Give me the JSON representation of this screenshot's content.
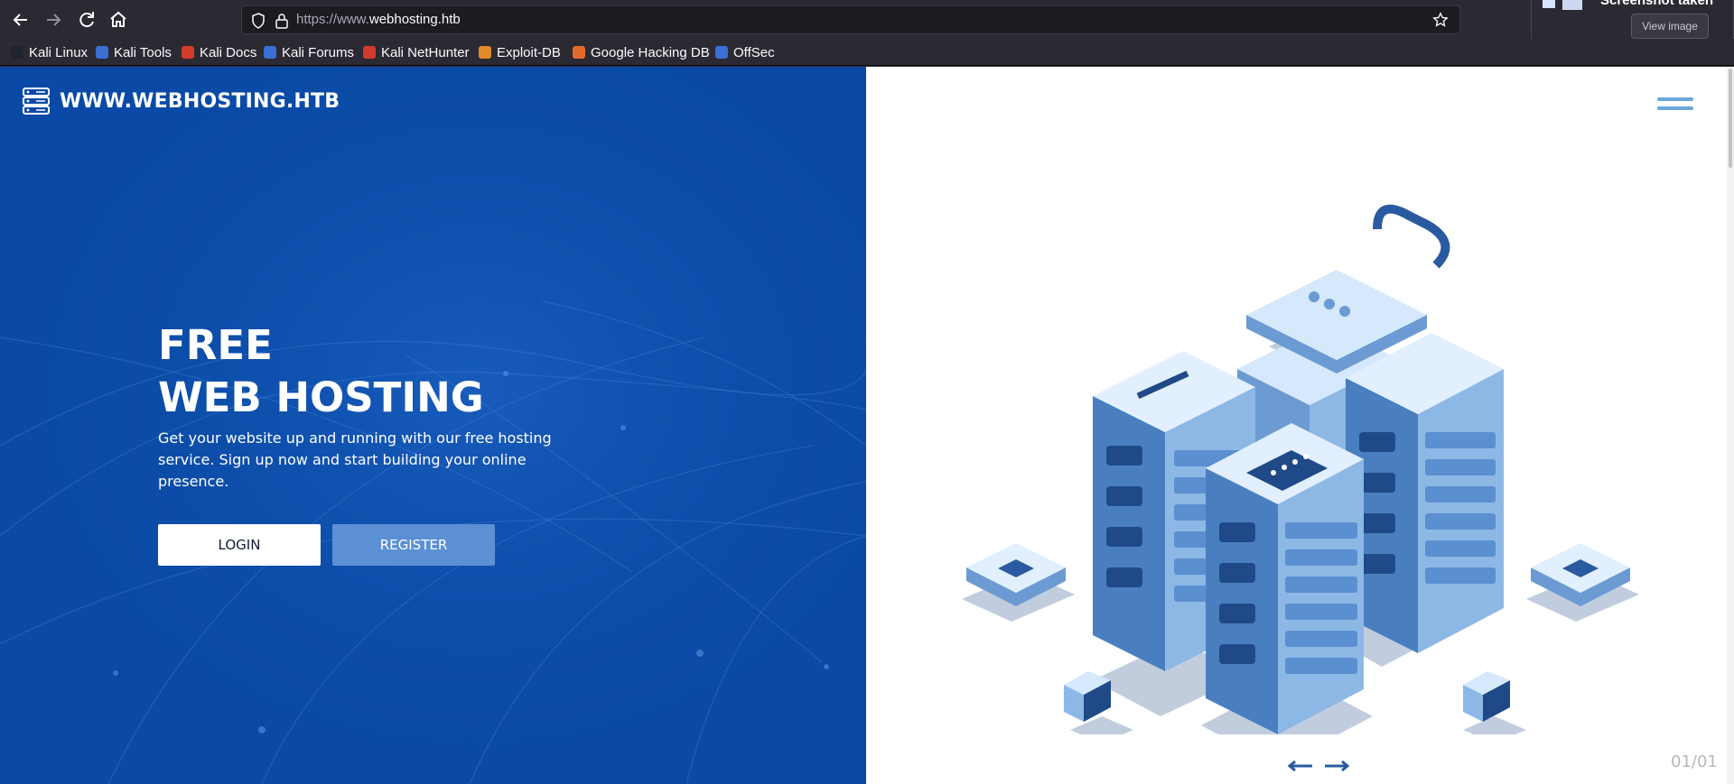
{
  "browser": {
    "url_prefix": "https://www.",
    "url_domain": "webhosting.htb",
    "nav": {
      "back_icon": "arrow-left-icon",
      "forward_icon": "arrow-right-icon",
      "reload_icon": "reload-icon",
      "home_icon": "home-icon"
    },
    "bookmarks": [
      {
        "label": "Kali Linux",
        "color": "#1f2430"
      },
      {
        "label": "Kali Tools",
        "color": "#3b6fd4"
      },
      {
        "label": "Kali Docs",
        "color": "#d33b2c"
      },
      {
        "label": "Kali Forums",
        "color": "#3b6fd4"
      },
      {
        "label": "Kali NetHunter",
        "color": "#d33b2c"
      },
      {
        "label": "Exploit-DB",
        "color": "#e38a2b"
      },
      {
        "label": "Google Hacking DB",
        "color": "#e36a2b"
      },
      {
        "label": "OffSec",
        "color": "#3b6fd4"
      }
    ],
    "popup": {
      "title": "Screenshot taken",
      "button": "View image"
    }
  },
  "site": {
    "brand": "WWW.WEBHOSTING.HTB",
    "hero": {
      "title_line1": "FREE",
      "title_line2": "WEB HOSTING",
      "description": "Get your website up and running with our free hosting service. Sign up now and start building your online presence.",
      "login_label": "LOGIN",
      "register_label": "REGISTER"
    },
    "slider": {
      "counter": "01/01"
    },
    "colors": {
      "hero_blue": "#0a4aa6",
      "register_button": "#5b90d4",
      "accent_light": "#6aa7dc"
    }
  }
}
